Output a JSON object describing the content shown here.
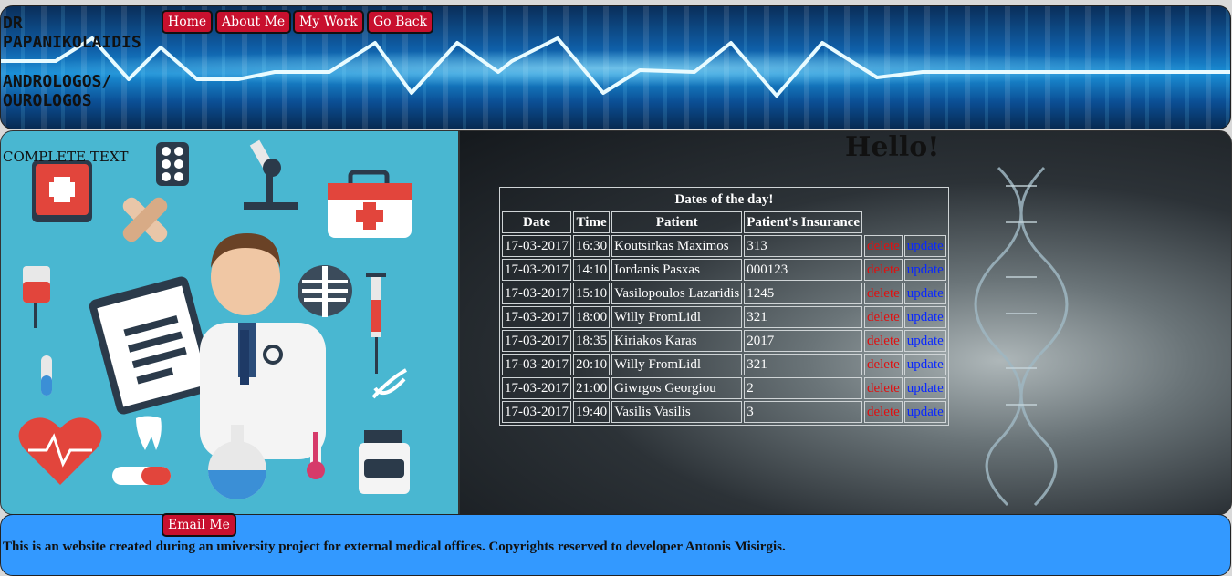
{
  "header": {
    "brand_line1": "DR PAPANIKOLAIDIS",
    "brand_line2": "ANDROLOGOS/ OUROLOGOS",
    "nav": [
      {
        "label": "Home"
      },
      {
        "label": "About Me"
      },
      {
        "label": "My Work"
      },
      {
        "label": "Go Back"
      }
    ]
  },
  "left": {
    "caption": "COMPLETE TEXT"
  },
  "main": {
    "greeting": "Hello!",
    "table": {
      "caption": "Dates of the day!",
      "columns": [
        "Date",
        "Time",
        "Patient",
        "Patient's Insurance"
      ],
      "rows": [
        {
          "date": "17-03-2017",
          "time": "16:30",
          "patient": "Koutsirkas Maximos",
          "insurance": "313",
          "delete": "delete",
          "update": "update"
        },
        {
          "date": "17-03-2017",
          "time": "14:10",
          "patient": "Iordanis Pasxas",
          "insurance": "000123",
          "delete": "delete",
          "update": "update"
        },
        {
          "date": "17-03-2017",
          "time": "15:10",
          "patient": "Vasilopoulos Lazaridis",
          "insurance": "1245",
          "delete": "delete",
          "update": "update"
        },
        {
          "date": "17-03-2017",
          "time": "18:00",
          "patient": "Willy FromLidl",
          "insurance": "321",
          "delete": "delete",
          "update": "update"
        },
        {
          "date": "17-03-2017",
          "time": "18:35",
          "patient": "Kiriakos Karas",
          "insurance": "2017",
          "delete": "delete",
          "update": "update"
        },
        {
          "date": "17-03-2017",
          "time": "20:10",
          "patient": "Willy FromLidl",
          "insurance": "321",
          "delete": "delete",
          "update": "update"
        },
        {
          "date": "17-03-2017",
          "time": "21:00",
          "patient": "Giwrgos Georgiou",
          "insurance": "2",
          "delete": "delete",
          "update": "update"
        },
        {
          "date": "17-03-2017",
          "time": "19:40",
          "patient": "Vasilis Vasilis",
          "insurance": "3",
          "delete": "delete",
          "update": "update"
        }
      ]
    }
  },
  "footer": {
    "email_label": "Email Me",
    "text": "This is an website created during an university project for external medical offices. Copyrights reserved to developer Antonis Misirgis."
  },
  "colors": {
    "nav_button": "#c8102e",
    "delete_link": "#e01010",
    "update_link": "#0a28ff",
    "footer_bg": "#3399ff"
  }
}
